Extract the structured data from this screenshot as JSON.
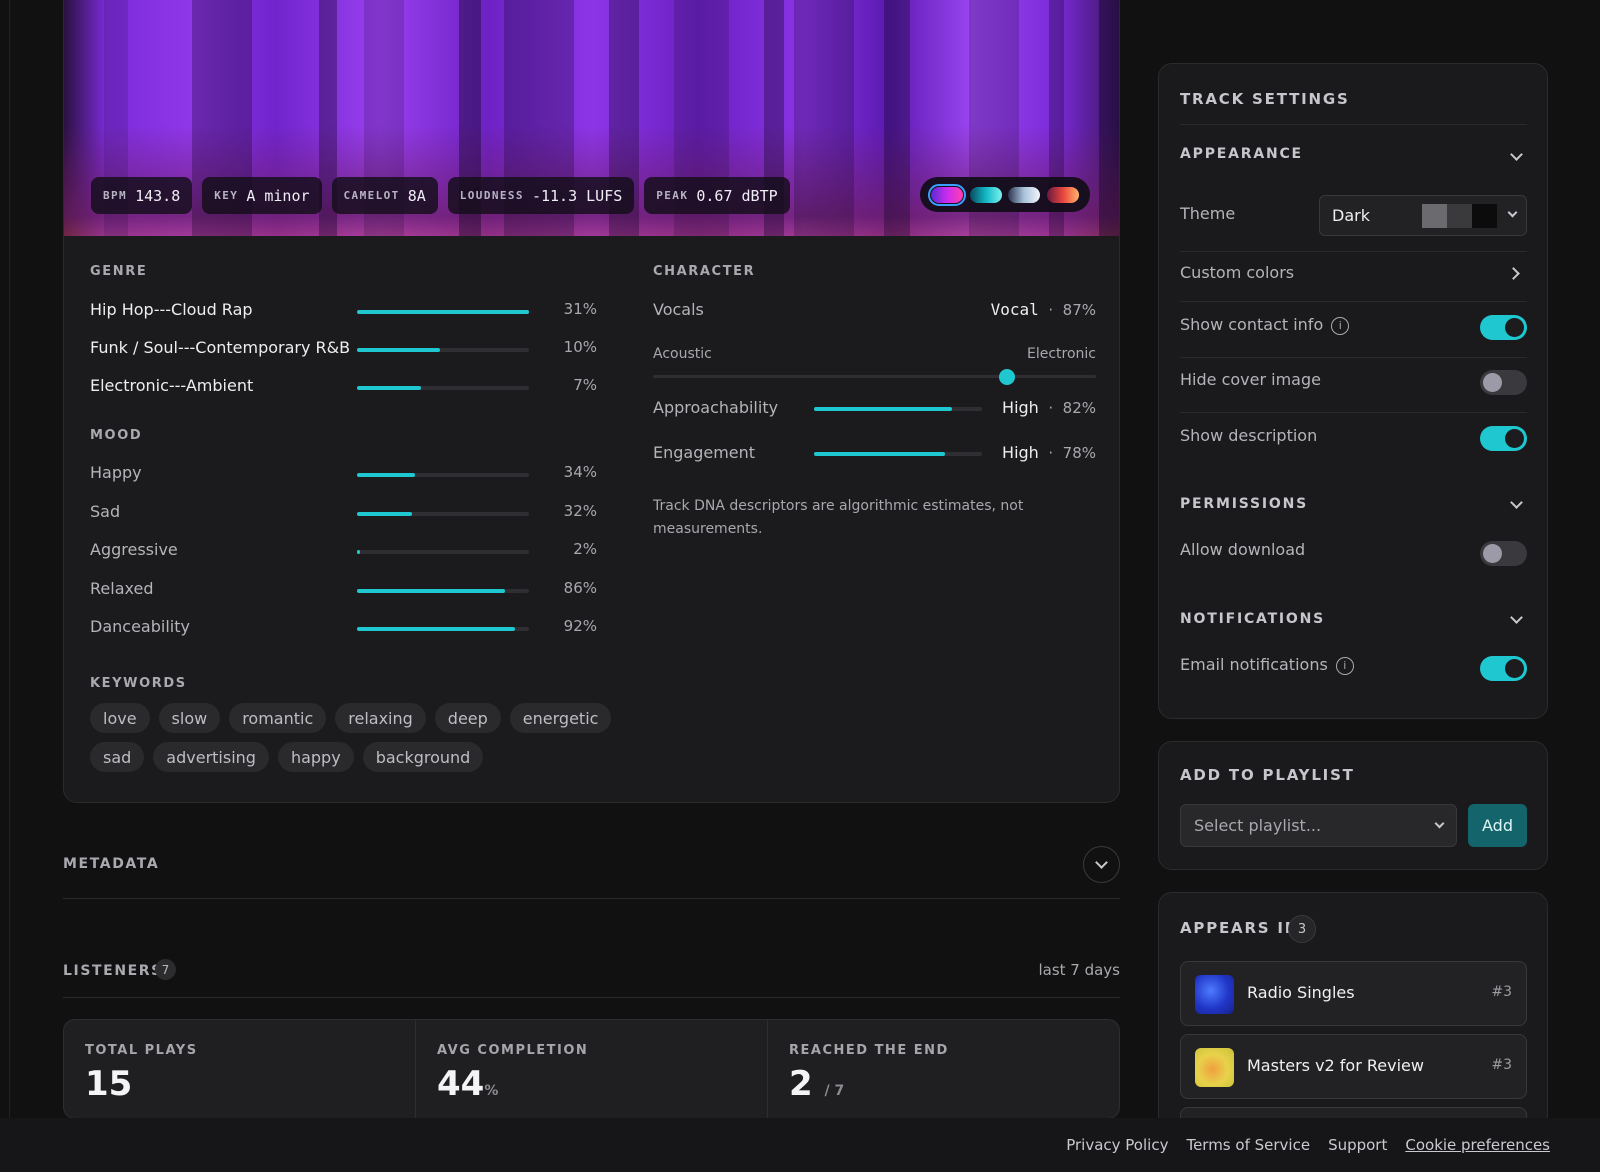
{
  "track_stats": [
    {
      "key": "BPM",
      "value": "143.8"
    },
    {
      "key": "KEY",
      "value": "A minor"
    },
    {
      "key": "CAMELOT",
      "value": "8A"
    },
    {
      "key": "LOUDNESS",
      "value": "-11.3 LUFS"
    },
    {
      "key": "PEAK",
      "value": "0.67 dBTP"
    }
  ],
  "palette_colors": [
    "#c92cf0",
    "#12b8c4",
    "#a9c2da",
    "#e8463e"
  ],
  "genre": {
    "label": "GENRE",
    "items": [
      {
        "name": "Hip Hop---Cloud Rap",
        "pct": "31%",
        "fill": 1.0
      },
      {
        "name": "Funk / Soul---Contemporary R&B",
        "pct": "10%",
        "fill": 0.48
      },
      {
        "name": "Electronic---Ambient",
        "pct": "7%",
        "fill": 0.37
      }
    ]
  },
  "mood": {
    "label": "MOOD",
    "items": [
      {
        "name": "Happy",
        "pct": "34%",
        "fill": 0.34
      },
      {
        "name": "Sad",
        "pct": "32%",
        "fill": 0.32
      },
      {
        "name": "Aggressive",
        "pct": "2%",
        "fill": 0.02
      },
      {
        "name": "Relaxed",
        "pct": "86%",
        "fill": 0.86
      },
      {
        "name": "Danceability",
        "pct": "92%",
        "fill": 0.92
      }
    ]
  },
  "keywords": {
    "label": "KEYWORDS",
    "row1": [
      "love",
      "slow",
      "romantic",
      "relaxing",
      "deep",
      "energetic"
    ],
    "row2": [
      "sad",
      "advertising",
      "happy",
      "background"
    ]
  },
  "character": {
    "label": "CHARACTER",
    "vocals_label": "Vocals",
    "vocals_value": "Vocal",
    "vocals_pct": "87%",
    "scale_left": "Acoustic",
    "scale_right": "Electronic",
    "scale_position": 0.8,
    "metrics": [
      {
        "name": "Approachability",
        "level": "High",
        "pct": "82%",
        "fill": 0.82
      },
      {
        "name": "Engagement",
        "level": "High",
        "pct": "78%",
        "fill": 0.78
      }
    ],
    "note": "Track DNA descriptors are algorithmic estimates, not measurements."
  },
  "metadata": {
    "label": "METADATA"
  },
  "listeners": {
    "label": "LISTENERS",
    "count": "7",
    "range": "last 7 days"
  },
  "stats": {
    "total_plays_label": "TOTAL PLAYS",
    "total_plays": "15",
    "avg_completion_label": "AVG COMPLETION",
    "avg_completion": "44",
    "avg_completion_unit": "%",
    "reached_end_label": "REACHED THE END",
    "reached_end": "2",
    "reached_end_total": "/ 7"
  },
  "settings": {
    "title": "TRACK SETTINGS",
    "appearance_label": "APPEARANCE",
    "theme_label": "Theme",
    "theme_value": "Dark",
    "custom_colors": "Custom colors",
    "show_contact": "Show contact info",
    "show_contact_on": true,
    "hide_cover": "Hide cover image",
    "hide_cover_on": false,
    "show_description": "Show description",
    "show_description_on": true,
    "permissions_label": "PERMISSIONS",
    "allow_download": "Allow download",
    "allow_download_on": false,
    "notifications_label": "NOTIFICATIONS",
    "email_notifications": "Email notifications",
    "email_notifications_on": true
  },
  "playlist": {
    "title": "ADD TO PLAYLIST",
    "placeholder": "Select playlist...",
    "add_label": "Add"
  },
  "appears_in": {
    "title": "APPEARS IN",
    "count": "3",
    "items": [
      {
        "name": "Radio Singles",
        "rank": "#3"
      },
      {
        "name": "Masters v2 for Review",
        "rank": "#3"
      }
    ]
  },
  "footer": {
    "privacy": "Privacy Policy",
    "terms": "Terms of Service",
    "support": "Support",
    "cookies": "Cookie preferences"
  },
  "colors": {
    "accent": "#1fc8d0",
    "background": "#111112"
  }
}
